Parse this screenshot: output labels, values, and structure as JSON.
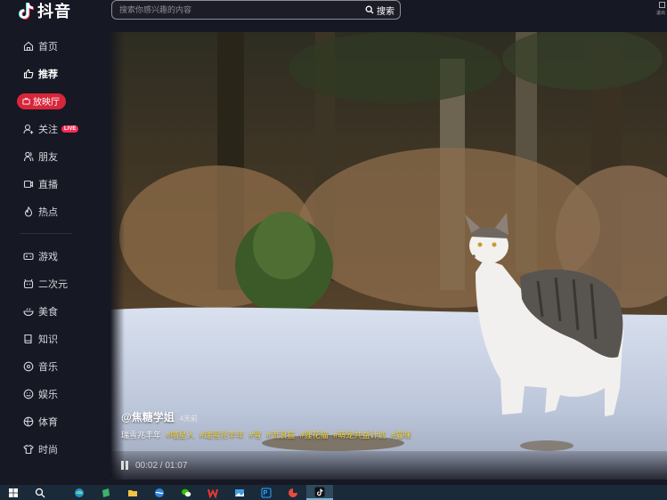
{
  "app": {
    "logo_text": "抖音"
  },
  "sidebar": {
    "items": [
      {
        "label": "首页",
        "icon": "home-icon"
      },
      {
        "label": "推荐",
        "icon": "thumbs-up-icon",
        "active": true
      },
      {
        "label": "放映厅",
        "icon": "tv-icon",
        "pill": true
      },
      {
        "label": "关注",
        "icon": "follow-icon",
        "badge": "LIVE"
      },
      {
        "label": "朋友",
        "icon": "friends-icon"
      },
      {
        "label": "直播",
        "icon": "live-icon"
      },
      {
        "label": "热点",
        "icon": "flame-icon"
      },
      {
        "label": "游戏",
        "icon": "gamepad-icon"
      },
      {
        "label": "二次元",
        "icon": "anime-icon"
      },
      {
        "label": "美食",
        "icon": "food-icon"
      },
      {
        "label": "知识",
        "icon": "book-icon"
      },
      {
        "label": "音乐",
        "icon": "music-icon"
      },
      {
        "label": "娱乐",
        "icon": "smile-icon"
      },
      {
        "label": "体育",
        "icon": "ball-icon"
      },
      {
        "label": "时尚",
        "icon": "shirt-icon"
      }
    ]
  },
  "search": {
    "placeholder": "搜索你感兴趣的内容",
    "button_label": "搜索"
  },
  "corner_label": "退出",
  "video": {
    "author": "@焦糖学姐",
    "post_time": "4天前",
    "caption": "瑞雪兆丰年",
    "hashtags": [
      "#喵星人",
      "#瑞雪兆丰年",
      "#雪",
      "#流浪猫",
      "#狸花猫",
      "#萌宠共益计划",
      "#猫咪"
    ],
    "time_current": "00:02",
    "time_total": "01:07",
    "time_display": "00:02 / 01:07"
  },
  "taskbar": {
    "icons": [
      "windows-start-icon",
      "search-icon",
      "edge-icon",
      "notepad-icon",
      "file-explorer-icon",
      "browser-icon",
      "wechat-icon",
      "wps-icon",
      "photos-icon",
      "photoshop-icon",
      "app-icon",
      "douyin-icon"
    ]
  },
  "colors": {
    "accent": "#fe2c55",
    "hashtag": "#f3d43b",
    "background": "#161823"
  }
}
